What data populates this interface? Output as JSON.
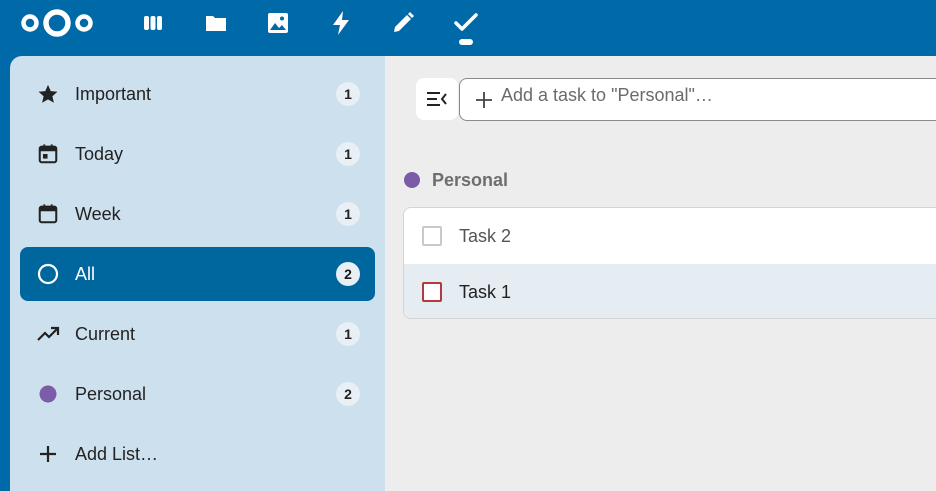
{
  "header": {
    "apps": [
      {
        "name": "dashboard-icon"
      },
      {
        "name": "files-icon"
      },
      {
        "name": "photos-icon"
      },
      {
        "name": "activity-icon"
      },
      {
        "name": "notes-icon"
      },
      {
        "name": "tasks-icon"
      }
    ],
    "active_app": "tasks-icon",
    "brand_color": "#0069a8"
  },
  "sidebar": {
    "items": [
      {
        "label": "Important",
        "count": "1",
        "icon": "star-icon"
      },
      {
        "label": "Today",
        "count": "1",
        "icon": "calendar-today-icon"
      },
      {
        "label": "Week",
        "count": "1",
        "icon": "calendar-week-icon"
      },
      {
        "label": "All",
        "count": "2",
        "icon": "circle-outline-icon",
        "active": true
      },
      {
        "label": "Current",
        "count": "1",
        "icon": "trending-up-icon"
      },
      {
        "label": "Personal",
        "count": "2",
        "icon": "color-dot-icon",
        "color": "#7b5ca8"
      },
      {
        "label": "Add List…",
        "icon": "plus-icon"
      }
    ]
  },
  "main": {
    "add_task": {
      "placeholder": "Add a task to \"Personal\"…"
    },
    "list": {
      "title": "Personal",
      "color": "#7b5ca8"
    },
    "tasks": [
      {
        "label": "Task 2",
        "checkbox_color": "#c9c9c9"
      },
      {
        "label": "Task 1",
        "checkbox_color": "#b23a3a"
      }
    ]
  }
}
